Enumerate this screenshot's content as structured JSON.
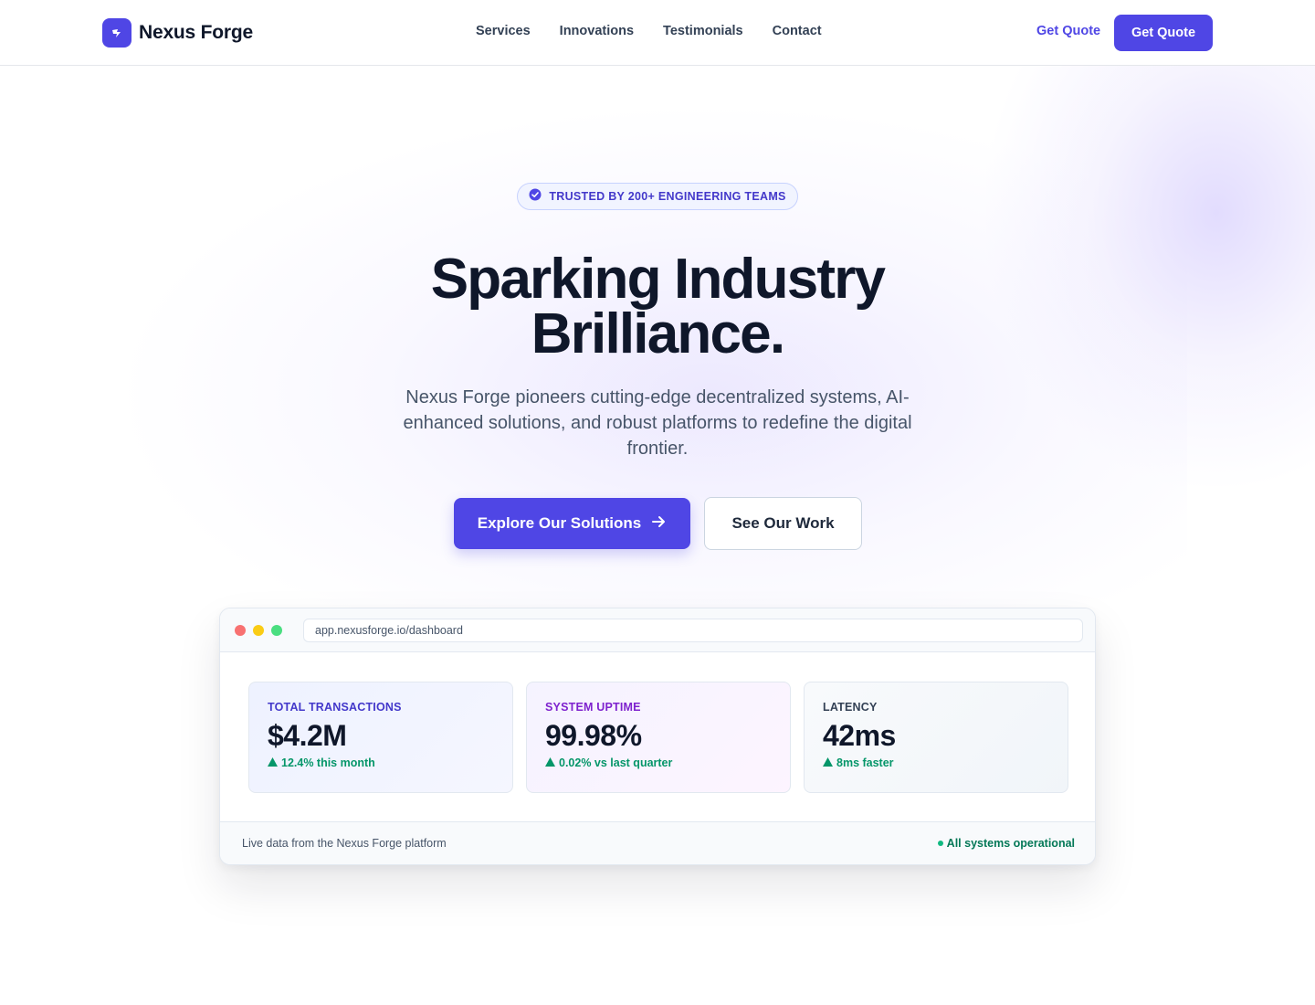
{
  "header": {
    "brand": "Nexus Forge",
    "nav": [
      "Services",
      "Innovations",
      "Testimonials",
      "Contact"
    ],
    "link_label": "Get Quote",
    "button_label": "Get Quote"
  },
  "hero": {
    "badge": "TRUSTED BY 200+ ENGINEERING TEAMS",
    "headline_line1": "Sparking Industry",
    "headline_line2": "Brilliance.",
    "subtext": "Nexus Forge pioneers cutting-edge decentralized systems, AI-enhanced solutions, and robust platforms to redefine the digital frontier.",
    "primary_cta": "Explore Our Solutions",
    "secondary_cta": "See Our Work"
  },
  "dashboard": {
    "url": "app.nexusforge.io/dashboard",
    "cards": [
      {
        "label": "TOTAL TRANSACTIONS",
        "value": "$4.2M",
        "delta": "12.4% this month"
      },
      {
        "label": "SYSTEM UPTIME",
        "value": "99.98%",
        "delta": "0.02% vs last quarter"
      },
      {
        "label": "LATENCY",
        "value": "42ms",
        "delta": "8ms faster"
      }
    ],
    "footer_left": "Live data from the Nexus Forge platform",
    "footer_right": "All systems operational"
  },
  "colors": {
    "accent": "#4f46e5",
    "positive": "#059669",
    "text": "#0f172a"
  },
  "icons": [
    "logo-bolt-icon",
    "verified-check-icon",
    "arrow-right-icon",
    "triangle-up-icon",
    "status-dot-icon"
  ]
}
